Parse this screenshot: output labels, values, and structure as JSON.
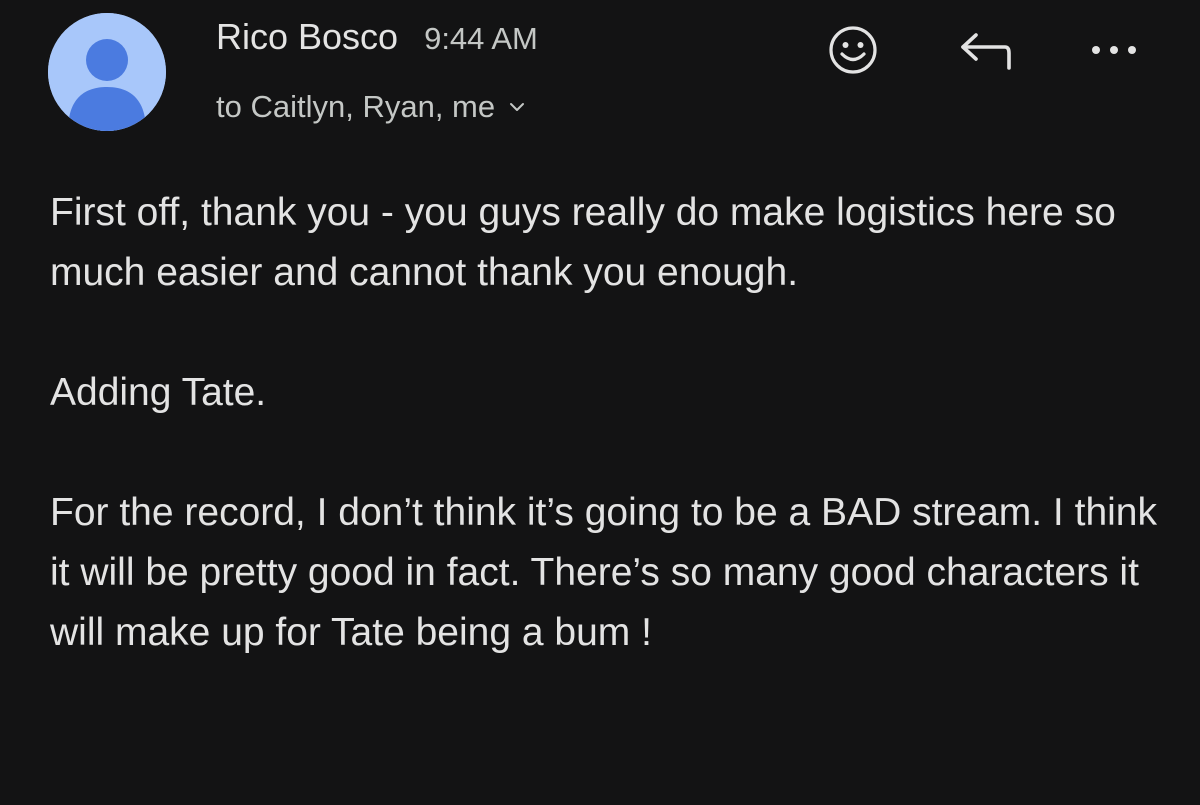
{
  "message": {
    "sender": {
      "name": "Rico Bosco",
      "time": "9:44 AM",
      "avatar_color": "#a8c7fa",
      "avatar_figure_color": "#4b7be0"
    },
    "recipients": "to Caitlyn, Ryan, me",
    "toolbar": {
      "emoji_icon": "smiley-face-icon",
      "reply_icon": "reply-arrow-icon",
      "more_icon": "more-dots-icon"
    },
    "body": [
      "First off, thank you - you guys really do make logistics here so much easier and cannot thank you enough.",
      "Adding Tate.",
      "For the record, I don’t think it’s going to be a BAD stream. I think it will be pretty good in fact. There’s so many good characters it will make up for Tate being a bum !"
    ]
  }
}
